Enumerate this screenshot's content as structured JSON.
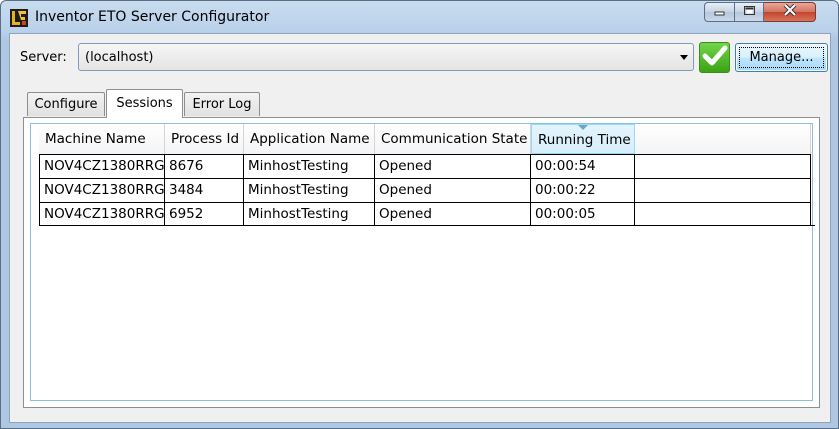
{
  "window": {
    "title": "Inventor ETO Server Configurator",
    "app_icon": "inventor-eto-icon",
    "controls": {
      "minimize": "minimize-icon",
      "maximize": "maximize-icon",
      "close": "close-icon"
    }
  },
  "server": {
    "label": "Server:",
    "selected": "(localhost)",
    "status_icon": "check-icon",
    "status_color": "#3aa314",
    "manage_label": "Manage..."
  },
  "tabs": [
    {
      "label": "Configure",
      "active": false
    },
    {
      "label": "Sessions",
      "active": true
    },
    {
      "label": "Error Log",
      "active": false
    }
  ],
  "sessions": {
    "columns": [
      "Machine Name",
      "Process Id",
      "Application Name",
      "Communication State",
      "Running Time"
    ],
    "sorted_column": "Running Time",
    "rows": [
      [
        "NOV4CZ1380RRG",
        "8676",
        "MinhostTesting",
        "Opened",
        "00:00:54"
      ],
      [
        "NOV4CZ1380RRG",
        "3484",
        "MinhostTesting",
        "Opened",
        "00:00:22"
      ],
      [
        "NOV4CZ1380RRG",
        "6952",
        "MinhostTesting",
        "Opened",
        "00:00:05"
      ]
    ]
  }
}
